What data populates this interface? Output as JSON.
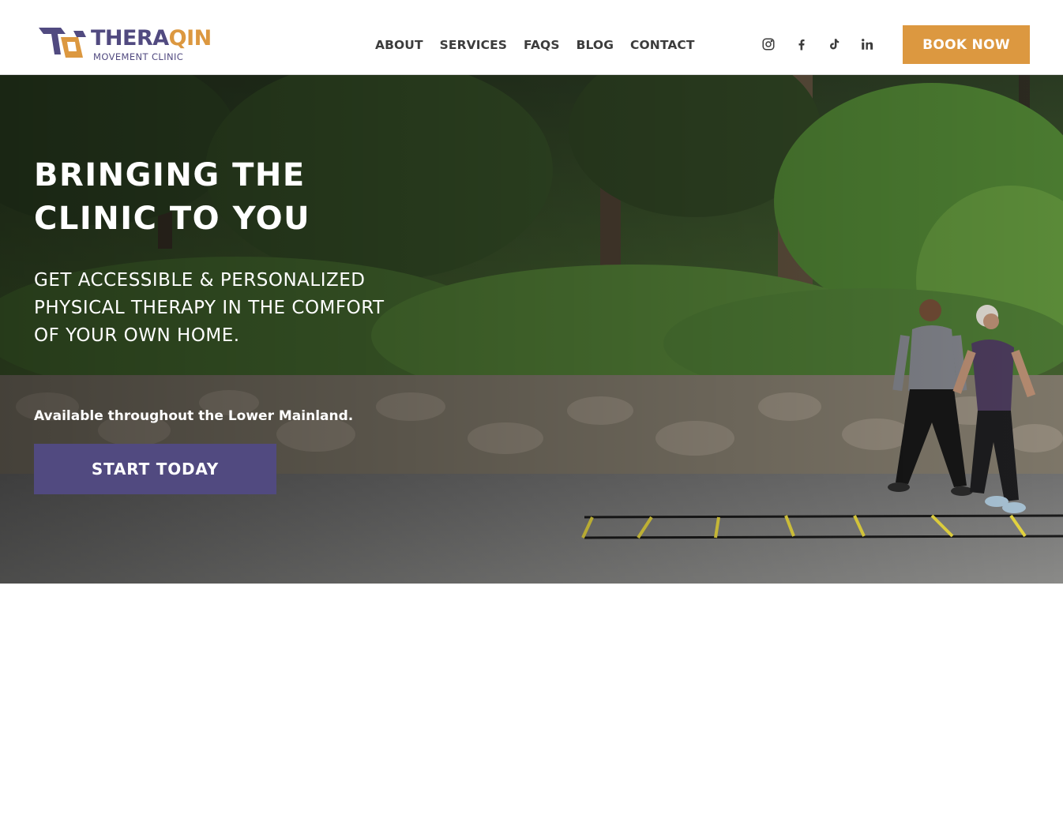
{
  "brand": {
    "name_part1": "THERA",
    "name_part2": "QIN",
    "tagline": "MOVEMENT CLINIC",
    "colors": {
      "primary": "#514a80",
      "accent": "#dc9840"
    }
  },
  "nav": {
    "items": [
      {
        "label": "ABOUT"
      },
      {
        "label": "SERVICES"
      },
      {
        "label": "FAQS"
      },
      {
        "label": "BLOG"
      },
      {
        "label": "CONTACT"
      }
    ]
  },
  "socials": [
    {
      "icon": "instagram-icon"
    },
    {
      "icon": "facebook-icon"
    },
    {
      "icon": "tiktok-icon"
    },
    {
      "icon": "linkedin-icon"
    }
  ],
  "header": {
    "book_label": "BOOK NOW"
  },
  "hero": {
    "title": "BRINGING THE CLINIC TO YOU",
    "subtitle": "GET ACCESSIBLE & PERSONALIZED PHYSICAL THERAPY IN THE COMFORT OF YOUR OWN HOME.",
    "availability": "Available throughout the Lower Mainland.",
    "cta_label": "START TODAY"
  }
}
